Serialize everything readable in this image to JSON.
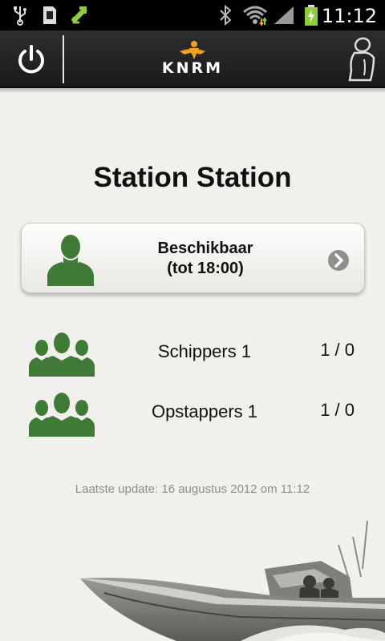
{
  "status_bar": {
    "time": "11:12",
    "icons": [
      "usb-icon",
      "sd-card-icon",
      "sync-icon",
      "bluetooth-icon",
      "wifi-icon",
      "signal-icon",
      "battery-charging-icon"
    ]
  },
  "action_bar": {
    "logo_text": "KNRM",
    "power_icon": "power-icon",
    "profile_icon": "person-outline-icon"
  },
  "station": {
    "title": "Station Station"
  },
  "availability": {
    "line1": "Beschikbaar",
    "line2": "(tot 18:00)",
    "icon": "person-icon",
    "chevron": "chevron-right-icon",
    "color": "#3f7a37"
  },
  "crew": [
    {
      "label": "Schippers 1",
      "count": "1 / 0",
      "icon": "group-icon"
    },
    {
      "label": "Opstappers 1",
      "count": "1 / 0",
      "icon": "group-icon"
    }
  ],
  "footer": {
    "last_update": "Laatste update: 16 augustus 2012 om 11:12"
  },
  "colors": {
    "accent_green": "#3f7a37",
    "logo_orange": "#f0a21e",
    "background": "#f1f0ec"
  }
}
